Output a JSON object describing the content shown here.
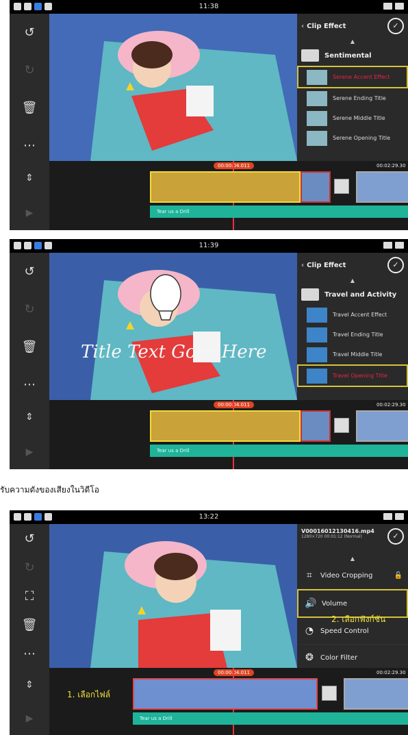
{
  "screens": [
    {
      "time": "11:38",
      "panel_title": "Clip Effect",
      "category": "Sentimental",
      "items": [
        {
          "label": "Serene Accent Effect",
          "selected": true
        },
        {
          "label": "Serene Ending Title",
          "selected": false
        },
        {
          "label": "Serene Middle Title",
          "selected": false
        },
        {
          "label": "Serene Opening Title",
          "selected": false
        }
      ],
      "playhead_time": "00:00:04.011",
      "end_time": "00:02:29.30",
      "audio_label": "Tear us a Drill"
    },
    {
      "time": "11:39",
      "panel_title": "Clip Effect",
      "category": "Travel and Activity",
      "items": [
        {
          "label": "Travel Accent Effect",
          "selected": false
        },
        {
          "label": "Travel Ending Title",
          "selected": false
        },
        {
          "label": "Travel Middle Title",
          "selected": false
        },
        {
          "label": "Travel Opening Title",
          "selected": true
        }
      ],
      "overlay_title": "Title Text Goes Here",
      "playhead_time": "00:00:04.011",
      "end_time": "00:02:29.30",
      "audio_label": "Tear us a Drill"
    },
    {
      "time": "13:22",
      "file_name": "V00016012130416.mp4",
      "file_meta": "1280×720 00:01:12 (Normal)",
      "menu": [
        {
          "label": "Video Cropping",
          "icon": "crop-icon",
          "selected": false
        },
        {
          "label": "Volume",
          "icon": "speaker-icon",
          "selected": true
        },
        {
          "label": "Speed Control",
          "icon": "speed-icon",
          "selected": false
        },
        {
          "label": "Color Filter",
          "icon": "color-filter-icon",
          "selected": false
        }
      ],
      "annotation_1": "1. เลือกไฟล์",
      "annotation_2": "2. เลือกฟังก์ชัน",
      "playhead_time": "00:00:04.011",
      "end_time": "00:02:29.30",
      "audio_label": "Tear us a Drill"
    }
  ],
  "caption": "รับความดังของเสียงในวิดีโอ"
}
